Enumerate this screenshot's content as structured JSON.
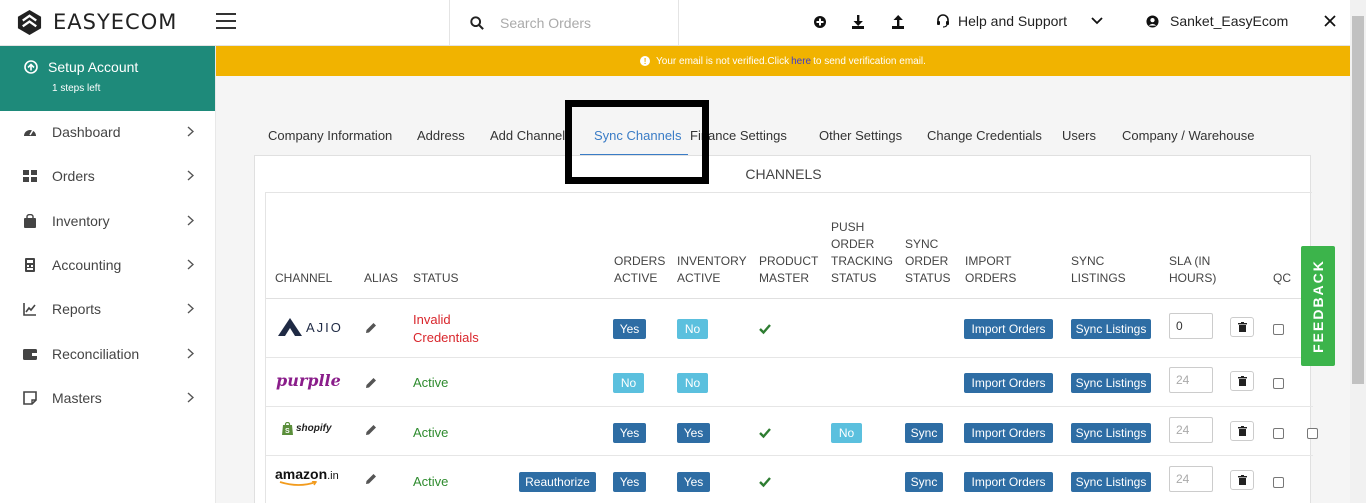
{
  "app": {
    "logo_text": "EASYECOM"
  },
  "header": {
    "search_placeholder": "Search Orders",
    "help_label": "Help and Support",
    "user_name": "Sanket_EasyEcom"
  },
  "sidebar": {
    "setup_title": "Setup Account",
    "setup_sub": "1 steps left",
    "items": [
      {
        "label": "Dashboard",
        "icon": "dashboard-icon"
      },
      {
        "label": "Orders",
        "icon": "grid-icon"
      },
      {
        "label": "Inventory",
        "icon": "bag-icon"
      },
      {
        "label": "Accounting",
        "icon": "accounting-icon"
      },
      {
        "label": "Reports",
        "icon": "chart-line-icon"
      },
      {
        "label": "Reconciliation",
        "icon": "wallet-icon"
      },
      {
        "label": "Masters",
        "icon": "note-icon"
      }
    ]
  },
  "banner": {
    "text_before": "Your email is not verified.Click",
    "link": "here",
    "text_after": "to send verification email."
  },
  "tabs": [
    "Company Information",
    "Address",
    "Add Channels",
    "Sync Channels",
    "Finance Settings",
    "Other Settings",
    "Change Credentials",
    "Users",
    "Company / Warehouse"
  ],
  "active_tab": "Sync Channels",
  "panel": {
    "title": "CHANNELS"
  },
  "table": {
    "headers": {
      "channel": "CHANNEL",
      "alias": "ALIAS",
      "status": "STATUS",
      "orders_active": [
        "ORDERS",
        "ACTIVE"
      ],
      "inventory_active": [
        "INVENTORY",
        "ACTIVE"
      ],
      "product_master": [
        "PRODUCT",
        "MASTER"
      ],
      "push_order": [
        "PUSH",
        "ORDER",
        "TRACKING",
        "STATUS"
      ],
      "sync_order": [
        "SYNC",
        "ORDER",
        "STATUS"
      ],
      "import_orders": [
        "IMPORT",
        "ORDERS"
      ],
      "sync_listings": [
        "SYNC",
        "LISTINGS"
      ],
      "sla": [
        "SLA (IN",
        "HOURS)"
      ],
      "qc": "QC"
    },
    "rows": [
      {
        "channel_logo": "AJIO",
        "status_line1": "Invalid",
        "status_line2": "Credentials",
        "orders_active": "Yes",
        "inventory_active": "No",
        "import_btn": "Import Orders",
        "sync_listings_btn": "Sync Listings",
        "sla_value": "0"
      },
      {
        "channel_logo": "purplle",
        "status": "Active",
        "orders_active": "No",
        "inventory_active": "No",
        "import_btn": "Import Orders",
        "sync_listings_btn": "Sync Listings",
        "sla_placeholder": "24"
      },
      {
        "channel_logo": "shopify",
        "status": "Active",
        "orders_active": "Yes",
        "inventory_active": "Yes",
        "push_order": "No",
        "sync_order": "Sync",
        "import_btn": "Import Orders",
        "sync_listings_btn": "Sync Listings",
        "sla_placeholder": "24"
      },
      {
        "channel_logo_main": "amazon",
        "channel_logo_suffix": ".in",
        "status": "Active",
        "reauthorize": "Reauthorize",
        "orders_active": "Yes",
        "inventory_active": "Yes",
        "sync_order": "Sync",
        "import_btn": "Import Orders",
        "sync_listings_btn": "Sync Listings",
        "sla_placeholder": "24"
      }
    ]
  },
  "feedback": "FEEDBACK",
  "colors": {
    "sidebar_setup": "#1e8a7a",
    "banner": "#f1b300",
    "primary_button": "#2e6da4",
    "info_button": "#5bc0de",
    "active_tab": "#3a7cc6",
    "feedback": "#3cb44b",
    "status_ok": "#2e8b2e",
    "status_error": "#d9262c"
  }
}
